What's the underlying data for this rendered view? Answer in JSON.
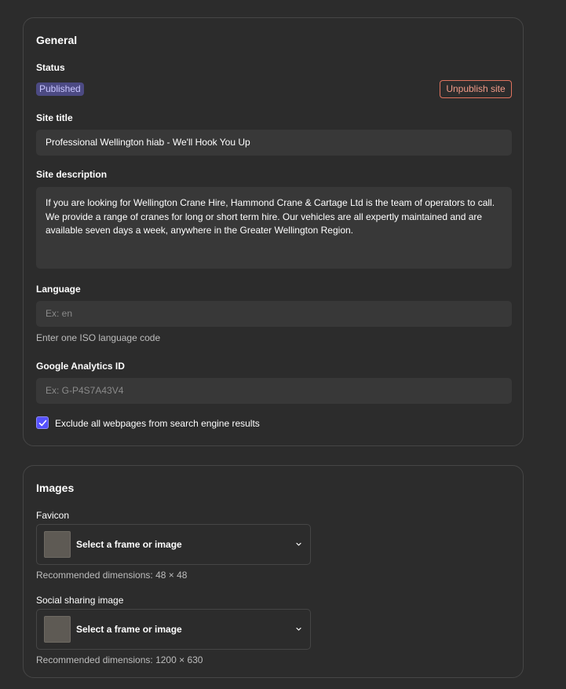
{
  "general": {
    "title": "General",
    "status": {
      "label": "Status",
      "badge": "Published",
      "unpublish_button": "Unpublish site"
    },
    "site_title": {
      "label": "Site title",
      "value": "Professional Wellington hiab - We'll Hook You Up"
    },
    "site_description": {
      "label": "Site description",
      "value": "If you are looking for Wellington Crane Hire, Hammond Crane & Cartage Ltd is the team of operators to call. We provide a range of cranes for long or short term hire. Our vehicles are all expertly maintained and are available seven days a week, anywhere in the Greater Wellington Region."
    },
    "language": {
      "label": "Language",
      "placeholder": "Ex: en",
      "helper": "Enter one ISO language code"
    },
    "analytics": {
      "label": "Google Analytics ID",
      "placeholder": "Ex: G-P4S7A43V4"
    },
    "exclude_search": {
      "label": "Exclude all webpages from search engine results",
      "checked": true
    }
  },
  "images": {
    "title": "Images",
    "favicon": {
      "label": "Favicon",
      "picker_label": "Select a frame or image",
      "helper": "Recommended dimensions: 48 × 48"
    },
    "social": {
      "label": "Social sharing image",
      "picker_label": "Select a frame or image",
      "helper": "Recommended dimensions: 1200 × 630"
    }
  },
  "colors": {
    "background": "#2c2c2c",
    "input_bg": "#383838",
    "accent": "#5551ff",
    "danger": "#e0735e",
    "badge_bg": "#4c4a83"
  },
  "icons": [
    "checkmark-icon",
    "chevron-down-icon"
  ]
}
